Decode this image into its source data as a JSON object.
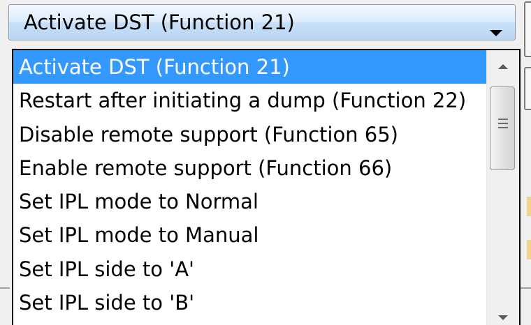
{
  "combo": {
    "selected_value": "Activate DST (Function 21)",
    "arrow_icon": "dropdown-arrow-icon"
  },
  "dropdown": {
    "items": [
      {
        "label": "Activate DST (Function 21)",
        "selected": true
      },
      {
        "label": "Restart after initiating a dump (Function 22)",
        "selected": false
      },
      {
        "label": "Disable remote support (Function 65)",
        "selected": false
      },
      {
        "label": "Enable remote support (Function 66)",
        "selected": false
      },
      {
        "label": "Set IPL mode to Normal",
        "selected": false
      },
      {
        "label": "Set IPL mode to Manual",
        "selected": false
      },
      {
        "label": "Set IPL side to 'A'",
        "selected": false
      },
      {
        "label": "Set IPL side to 'B'",
        "selected": false
      }
    ],
    "selection_color": "#3399ff"
  },
  "scrollbar": {
    "up_icon": "scroll-up-arrow-icon",
    "down_icon": "scroll-down-arrow-icon",
    "thumb_icon": "scroll-thumb-grip-icon"
  }
}
